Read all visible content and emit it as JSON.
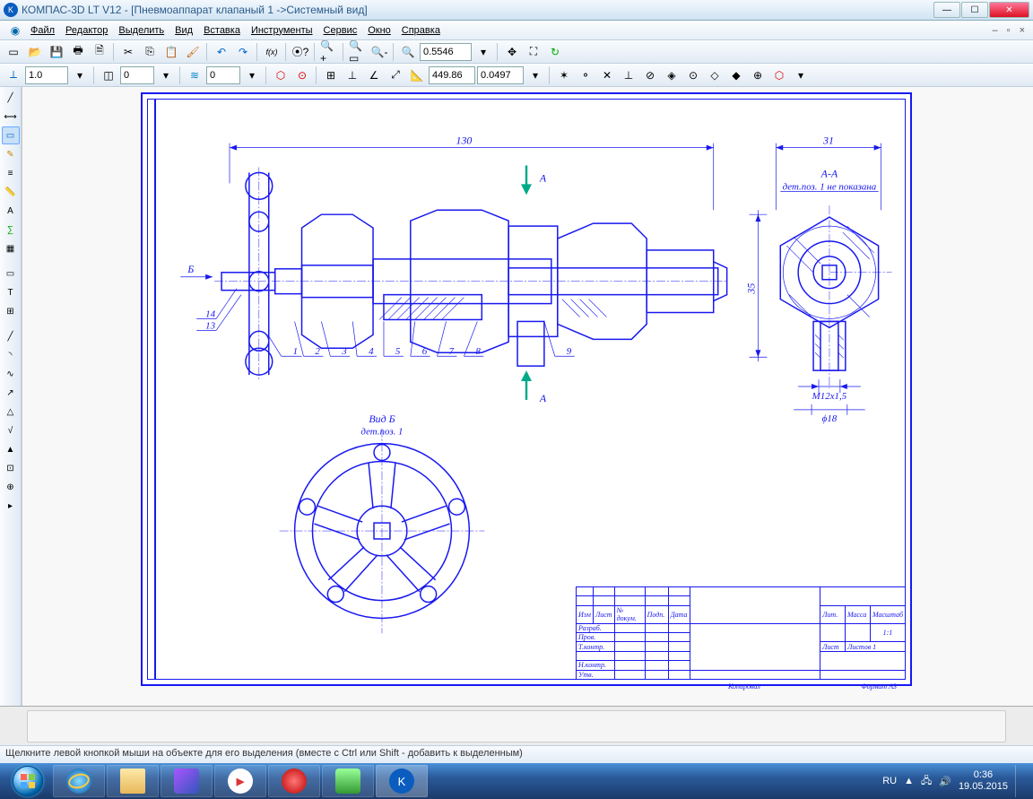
{
  "window": {
    "title": "КОМПАС-3D LT V12 - [Пневмоаппарат клапаный 1 ->Системный вид]",
    "min": "—",
    "max": "☐",
    "close": "✕"
  },
  "menu": {
    "file": "Файл",
    "edit": "Редактор",
    "select": "Выделить",
    "view": "Вид",
    "insert": "Вставка",
    "tools": "Инструменты",
    "service": "Сервис",
    "window": "Окно",
    "help": "Справка"
  },
  "toolbar1": {
    "zoom_value": "0.5546"
  },
  "toolbar3": {
    "width": "1.0",
    "style": "0",
    "step": "0",
    "coord_x": "449.86",
    "coord_y": "0.0497"
  },
  "drawing": {
    "dim_130": "130",
    "dim_31": "31",
    "dim_35": "35",
    "section_A_top": "А",
    "section_A_bot": "А",
    "label_B": "Б",
    "view_AA": "А-А",
    "view_AA_note": "дет.поз. 1 не показана",
    "view_B": "Вид Б",
    "view_B_note": "дет.поз. 1",
    "dim_M12": "М12х1,5",
    "dim_phi18": "ϕ18",
    "p1": "1",
    "p2": "2",
    "p3": "3",
    "p4": "4",
    "p5": "5",
    "p6": "6",
    "p7": "7",
    "p8": "8",
    "p9": "9",
    "p13": "13",
    "p14": "14"
  },
  "titleblock": {
    "izm": "Изм",
    "list": "Лист",
    "ndoc": "№ докум.",
    "podp": "Подп.",
    "data": "Дата",
    "razrab": "Разраб.",
    "prov": "Пров.",
    "tkontr": "Т.контр.",
    "nkontr": "Н.контр.",
    "utv": "Утв.",
    "lit": "Лит.",
    "massa": "Масса",
    "masshtab": "Масштаб",
    "scale": "1:1",
    "list2": "Лист",
    "listov": "Листов   1",
    "kopiroval": "Копировал",
    "format": "Формат    А3"
  },
  "status": "Щелкните левой кнопкой мыши на объекте для его выделения (вместе с Ctrl или Shift - добавить к выделенным)",
  "tray": {
    "lang": "RU",
    "time": "0:36",
    "date": "19.05.2015"
  }
}
